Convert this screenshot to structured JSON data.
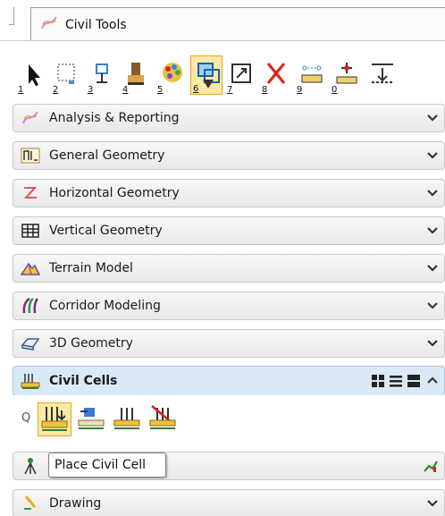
{
  "window": {
    "title": "Civil Tools",
    "title_icon": "civil-tools-icon"
  },
  "toolbar": {
    "tools": [
      {
        "number": "1",
        "icon": "select-arrow-icon",
        "selected": false
      },
      {
        "number": "2",
        "icon": "dotted-selection-icon",
        "selected": false
      },
      {
        "number": "3",
        "icon": "element-selection-icon",
        "selected": false
      },
      {
        "number": "4",
        "icon": "paint-brush-icon",
        "selected": false
      },
      {
        "number": "5",
        "icon": "palette-icon",
        "selected": false
      },
      {
        "number": "6",
        "icon": "overlay-selection-icon",
        "selected": true
      },
      {
        "number": "7",
        "icon": "resize-icon",
        "selected": false
      },
      {
        "number": "8",
        "icon": "delete-x-icon",
        "selected": false
      },
      {
        "number": "9",
        "icon": "measure-distance-icon",
        "selected": false
      },
      {
        "number": "0",
        "icon": "measure-point-icon",
        "selected": false
      },
      {
        "number": "",
        "icon": "dimension-icon",
        "selected": false
      }
    ]
  },
  "sections": [
    {
      "label": "Analysis & Reporting",
      "icon": "analysis-reporting-icon"
    },
    {
      "label": "General Geometry",
      "icon": "general-geometry-icon"
    },
    {
      "label": "Horizontal Geometry",
      "icon": "horizontal-geometry-icon"
    },
    {
      "label": "Vertical Geometry",
      "icon": "vertical-geometry-icon"
    },
    {
      "label": "Terrain Model",
      "icon": "terrain-model-icon"
    },
    {
      "label": "Corridor Modeling",
      "icon": "corridor-modeling-icon"
    },
    {
      "label": "3D Geometry",
      "icon": "3d-geometry-icon"
    },
    {
      "label": "Civil Cells",
      "icon": "civil-cells-icon",
      "expanded": true
    },
    {
      "label": "",
      "icon": "survey-icon"
    },
    {
      "label": "Drawing",
      "icon": "drawing-icon"
    }
  ],
  "civil_cells": {
    "tools": [
      {
        "label": "Q",
        "icon": "search-icon"
      },
      {
        "label": "",
        "icon": "place-civil-cell-icon",
        "selected": true
      },
      {
        "label": "",
        "icon": "civil-cell-template-icon"
      },
      {
        "label": "",
        "icon": "civil-cell-edit-icon"
      },
      {
        "label": "",
        "icon": "civil-cell-remove-icon"
      }
    ],
    "view_icons": [
      "grid-view-icon",
      "list-view-icon",
      "panel-view-icon"
    ]
  },
  "tooltip": {
    "text": "Place Civil Cell"
  },
  "colors": {
    "selected_bg": "#fde9a6",
    "selected_border": "#e4a41e",
    "expanded_bg": "#dbe8f5",
    "delete_red": "#e0201b"
  }
}
